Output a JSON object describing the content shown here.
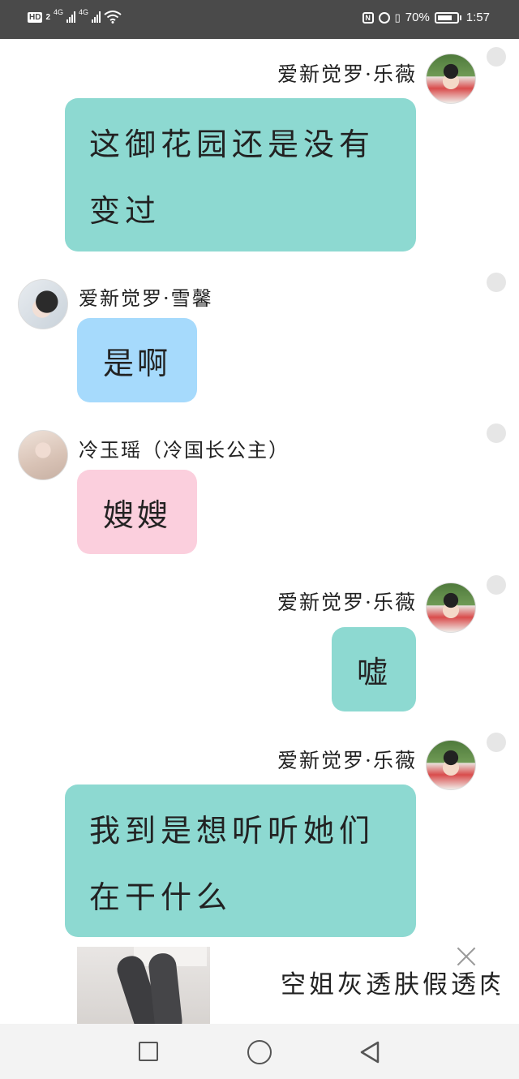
{
  "status_bar": {
    "hd": "HD",
    "sim": "2",
    "signal1": "4G",
    "signal2": "4G",
    "battery_pct": "70%",
    "time": "1:57"
  },
  "messages": [
    {
      "sender": "爱新觉罗·乐薇",
      "side": "right",
      "color": "#8dd9d1",
      "text_line1": "这御花园还是没有",
      "text_line2": "变过"
    },
    {
      "sender": "爱新觉罗·雪馨",
      "side": "left",
      "color": "#a6dafc",
      "text": "是啊"
    },
    {
      "sender": "冷玉瑶（冷国长公主）",
      "side": "left",
      "color": "#fbcfdd",
      "text": "嫂嫂"
    },
    {
      "sender": "爱新觉罗·乐薇",
      "side": "right",
      "color": "#8dd9d1",
      "text": "嘘"
    },
    {
      "sender": "爱新觉罗·乐薇",
      "side": "right",
      "color": "#8dd9d1",
      "text_line1": "我到是想听听她们",
      "text_line2": "在干什么"
    }
  ],
  "ad": {
    "title": "空姐灰透肤假透肉",
    "image_icon": "stockings-photo",
    "close_icon": "close-icon"
  },
  "nav": {
    "recent_icon": "square-icon",
    "home_icon": "circle-icon",
    "back_icon": "triangle-back-icon"
  }
}
